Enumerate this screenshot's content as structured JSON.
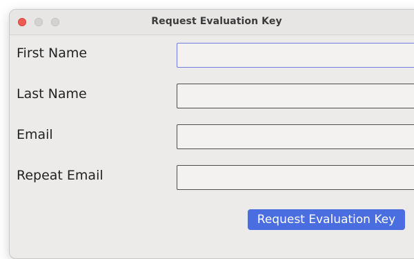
{
  "window": {
    "title": "Request Evaluation Key"
  },
  "form": {
    "fields": [
      {
        "label": "First Name",
        "value": ""
      },
      {
        "label": "Last Name",
        "value": ""
      },
      {
        "label": "Email",
        "value": ""
      },
      {
        "label": "Repeat Email",
        "value": ""
      }
    ],
    "submit_label": "Request Evaluation Key"
  },
  "colors": {
    "close_button": "#ee5b55",
    "focus_border": "#6e7ee0",
    "primary_button": "#4a6ee0"
  }
}
